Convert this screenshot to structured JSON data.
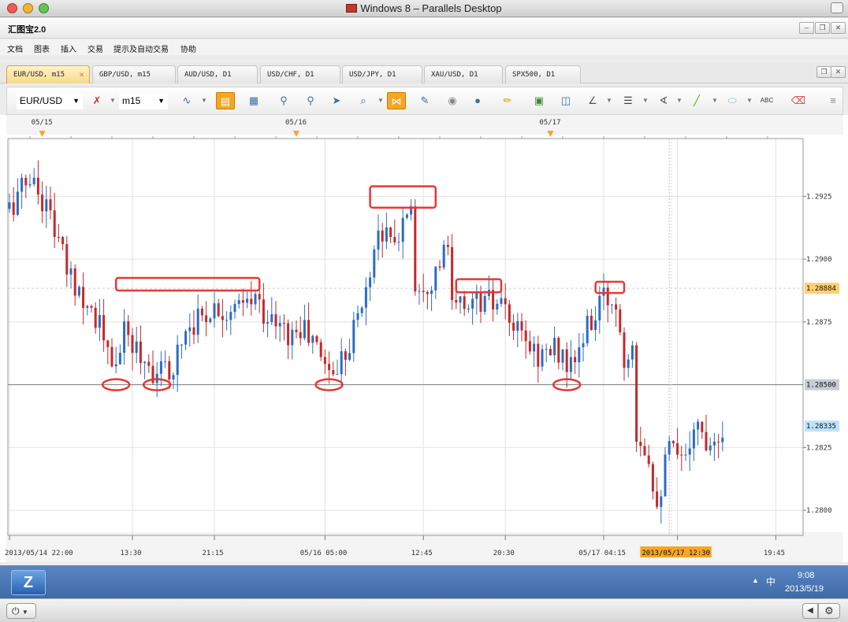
{
  "window": {
    "title": "Windows 8 – Parallels Desktop"
  },
  "app": {
    "title": "汇图宝2.0"
  },
  "menu": {
    "items": [
      "文档",
      "图表",
      "插入",
      "交易",
      "提示及自动交易",
      "协助"
    ]
  },
  "tabs": [
    {
      "label": "EUR/USD, m15",
      "active": true
    },
    {
      "label": "GBP/USD, m15"
    },
    {
      "label": "AUD/USD, D1"
    },
    {
      "label": "USD/CHF, D1"
    },
    {
      "label": "USD/JPY, D1"
    },
    {
      "label": "XAU/USD, D1"
    },
    {
      "label": "SPX500, D1"
    }
  ],
  "toolbar": {
    "symbol": "EUR/USD",
    "timeframe": "m15",
    "icons": [
      "line-chart-icon",
      "bar-chart-icon",
      "candle-chart-icon",
      "zoom-in-icon",
      "zoom-out-icon",
      "cursor-icon",
      "magnifier-icon",
      "crosshair-icon",
      "edit-icon",
      "eye-icon",
      "globe-icon",
      "ruler-icon",
      "image-icon",
      "screenshot-icon",
      "indicator-icon",
      "lines-icon",
      "fan-icon",
      "pencil-icon",
      "ellipse-icon",
      "text-icon",
      "eraser-icon"
    ]
  },
  "colors": {
    "bull": "#2b6cc4",
    "bear": "#c62828",
    "annotation": "#e53935",
    "accent": "#f6a623",
    "current_price_bg": "#ffd070",
    "level_price_bg": "#c8ccd6",
    "live_price_bg": "#bde3fb"
  },
  "chart_data": {
    "type": "candlestick",
    "symbol": "EUR/USD",
    "timeframe": "m15",
    "ylim": [
      1.279,
      1.2948
    ],
    "y_ticks": [
      "1.2925",
      "1.2900",
      "1.2875",
      "1.2825",
      "1.2800"
    ],
    "x_ticks": [
      "2013/05/14 22:00",
      "13:30",
      "21:15",
      "05/16 05:00",
      "12:45",
      "20:30",
      "05/17 04:15",
      "2013/05/17 12:30",
      "19:45"
    ],
    "x_tick_positions": [
      0,
      30,
      50,
      77,
      101,
      121,
      145,
      163,
      187
    ],
    "top_dates": [
      {
        "label": "05/15",
        "index": 8
      },
      {
        "label": "05/16",
        "index": 70
      },
      {
        "label": "05/17",
        "index": 132
      }
    ],
    "price_labels": [
      {
        "value": 1.28884,
        "label": "1.28884",
        "style": "current"
      },
      {
        "value": 1.285,
        "label": "1.28500",
        "style": "level"
      },
      {
        "value": 1.28335,
        "label": "1.28335",
        "style": "live"
      }
    ],
    "horizontal_line": 1.285,
    "cursor_index": 161,
    "cursor_label": "2013/05/17 12:30",
    "annotations": [
      {
        "shape": "rect",
        "i0": 26,
        "i1": 61,
        "p0": 1.28925,
        "p1": 1.28875
      },
      {
        "shape": "ellipse",
        "i": 26,
        "p": 1.285
      },
      {
        "shape": "ellipse",
        "i": 36,
        "p": 1.285
      },
      {
        "shape": "ellipse",
        "i": 78,
        "p": 1.285
      },
      {
        "shape": "rect",
        "i0": 88,
        "i1": 104,
        "p0": 1.2929,
        "p1": 1.29205
      },
      {
        "shape": "rect",
        "i0": 109,
        "i1": 120,
        "p0": 1.2892,
        "p1": 1.28868
      },
      {
        "shape": "ellipse",
        "i": 136,
        "p": 1.285
      },
      {
        "shape": "rect",
        "i0": 143,
        "i1": 150,
        "p0": 1.2891,
        "p1": 1.28865
      }
    ],
    "anchors": [
      [
        0,
        1.292
      ],
      [
        5,
        1.2933
      ],
      [
        10,
        1.2918
      ],
      [
        14,
        1.2895
      ],
      [
        18,
        1.2886
      ],
      [
        22,
        1.2874
      ],
      [
        25,
        1.2855
      ],
      [
        28,
        1.287
      ],
      [
        32,
        1.2862
      ],
      [
        35,
        1.2856
      ],
      [
        39,
        1.2854
      ],
      [
        43,
        1.2873
      ],
      [
        50,
        1.2881
      ],
      [
        55,
        1.2879
      ],
      [
        60,
        1.2884
      ],
      [
        64,
        1.2875
      ],
      [
        68,
        1.287
      ],
      [
        72,
        1.2872
      ],
      [
        76,
        1.2862
      ],
      [
        79,
        1.2854
      ],
      [
        83,
        1.2868
      ],
      [
        87,
        1.2887
      ],
      [
        90,
        1.2913
      ],
      [
        94,
        1.2905
      ],
      [
        97,
        1.292
      ],
      [
        98,
        1.2923
      ],
      [
        99,
        1.289
      ],
      [
        103,
        1.2892
      ],
      [
        107,
        1.2905
      ],
      [
        108,
        1.288
      ],
      [
        112,
        1.2883
      ],
      [
        117,
        1.2883
      ],
      [
        120,
        1.288
      ],
      [
        124,
        1.287
      ],
      [
        129,
        1.2862
      ],
      [
        134,
        1.2864
      ],
      [
        137,
        1.2856
      ],
      [
        141,
        1.2872
      ],
      [
        145,
        1.2884
      ],
      [
        148,
        1.2883
      ],
      [
        150,
        1.286
      ],
      [
        152,
        1.287
      ],
      [
        153,
        1.2832
      ],
      [
        156,
        1.2822
      ],
      [
        158,
        1.2803
      ],
      [
        161,
        1.2825
      ],
      [
        164,
        1.2818
      ],
      [
        167,
        1.2835
      ],
      [
        170,
        1.2828
      ],
      [
        174,
        1.2833
      ]
    ]
  },
  "taskbar": {
    "time": "9:08",
    "date": "2013/5/19",
    "ime": "中"
  }
}
